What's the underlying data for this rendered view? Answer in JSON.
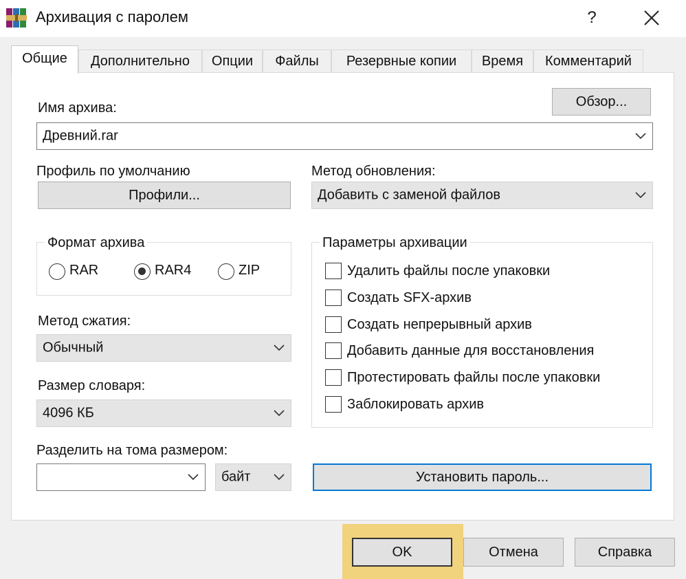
{
  "window": {
    "title": "Архивация с паролем",
    "help_label": "?"
  },
  "tabs": [
    {
      "label": "Общие"
    },
    {
      "label": "Дополнительно"
    },
    {
      "label": "Опции"
    },
    {
      "label": "Файлы"
    },
    {
      "label": "Резервные копии"
    },
    {
      "label": "Время"
    },
    {
      "label": "Комментарий"
    }
  ],
  "general": {
    "archive_name_label": "Имя архива:",
    "browse_label": "Обзор...",
    "archive_name_value": "Древний.rar",
    "default_profile_label": "Профиль по умолчанию",
    "profiles_label": "Профили...",
    "update_method_label": "Метод обновления:",
    "update_method_value": "Добавить с заменой файлов",
    "format_group_label": "Формат архива",
    "formats": [
      {
        "label": "RAR",
        "selected": false
      },
      {
        "label": "RAR4",
        "selected": true
      },
      {
        "label": "ZIP",
        "selected": false
      }
    ],
    "compression_label": "Метод сжатия:",
    "compression_value": "Обычный",
    "dictionary_label": "Размер словаря:",
    "dictionary_value": "4096 КБ",
    "split_label": "Разделить на тома размером:",
    "split_value": "",
    "split_unit_value": "байт",
    "options_group_label": "Параметры архивации",
    "options": [
      {
        "label": "Удалить файлы после упаковки",
        "checked": false
      },
      {
        "label": "Создать SFX-архив",
        "checked": false
      },
      {
        "label": "Создать непрерывный архив",
        "checked": false
      },
      {
        "label": "Добавить данные для восстановления",
        "checked": false
      },
      {
        "label": "Протестировать файлы после упаковки",
        "checked": false
      },
      {
        "label": "Заблокировать архив",
        "checked": false
      }
    ],
    "set_password_label": "Установить пароль..."
  },
  "footer": {
    "ok_label": "OK",
    "cancel_label": "Отмена",
    "help_label": "Справка"
  },
  "colors": {
    "ok_highlight": "#f1d27d",
    "focus_border": "#0078d7"
  },
  "icons": {
    "app": "winrar-icon",
    "close": "close-icon",
    "chevron": "chevron-down-icon"
  }
}
